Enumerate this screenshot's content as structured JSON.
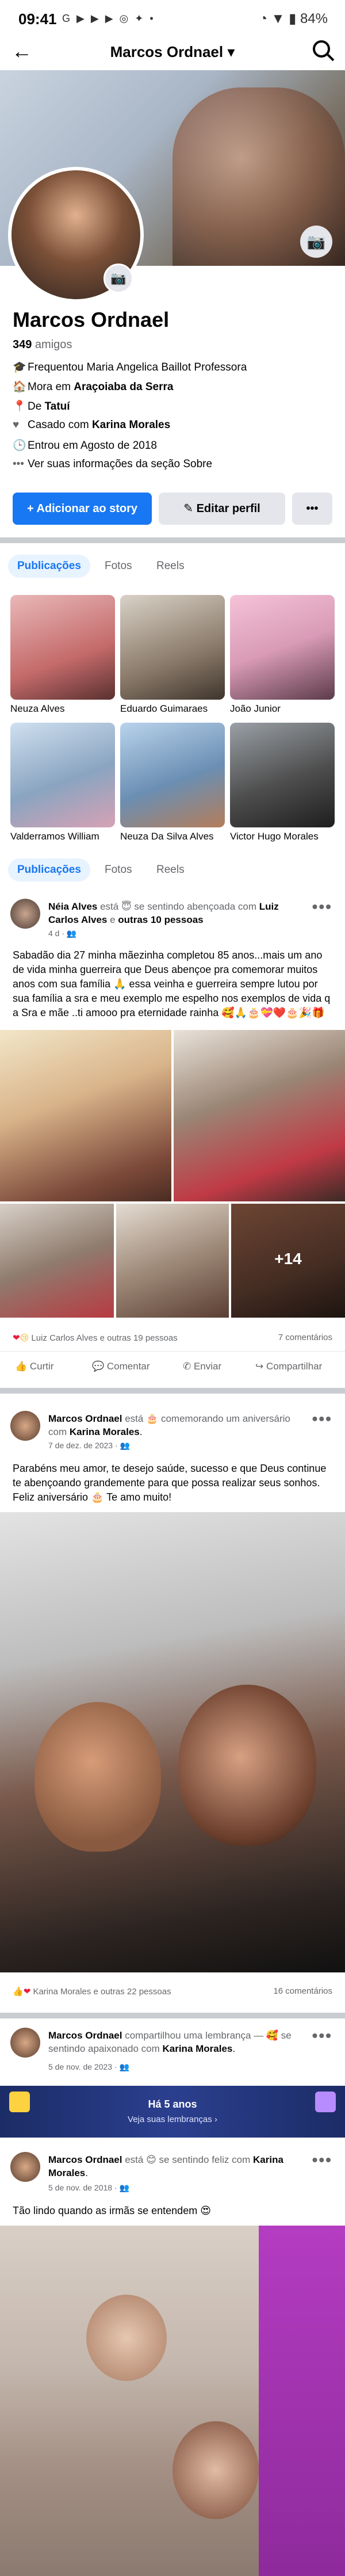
{
  "status_bar": {
    "time": "09:41",
    "icons": "G ▶ ▶ ▶ ◎ ✦ •",
    "right": "◔ ▼ ▮ 84%"
  },
  "top_bar": {
    "title": "Marcos Ordnael ▾"
  },
  "profile": {
    "name": "Marcos Ordnael",
    "friends_count": "349",
    "friends_label": " amigos",
    "info": [
      {
        "icon": "🎓",
        "prefix": "Frequentou ",
        "bold": "",
        "text": "Maria Angelica Baillot Professora"
      },
      {
        "icon": "🏠",
        "prefix": "Mora em ",
        "bold": "Araçoiaba da Serra",
        "text": ""
      },
      {
        "icon": "📍",
        "prefix": "De ",
        "bold": "Tatuí",
        "text": ""
      },
      {
        "icon": "♥",
        "prefix": "Casado com ",
        "bold": "Karina Morales",
        "text": ""
      },
      {
        "icon": "🕒",
        "prefix": "Entrou em Agosto de 2018",
        "bold": "",
        "text": ""
      },
      {
        "icon": "•••",
        "prefix": "Ver suas informações da seção Sobre",
        "bold": "",
        "text": ""
      }
    ],
    "btn_add": "+ Adicionar ao story",
    "btn_edit": "✎ Editar perfil",
    "btn_more": "•••"
  },
  "tabs": [
    "Publicações",
    "Fotos",
    "Reels"
  ],
  "friends_grid": [
    {
      "name": "Neuza Alves",
      "color": "#c46a6a"
    },
    {
      "name": "Eduardo Guimaraes",
      "color": "#8a7a6a"
    },
    {
      "name": "João Junior",
      "color": "#d99bb6"
    },
    {
      "name": "Valderramos William",
      "color": "#8aa4c0"
    },
    {
      "name": "Neuza Da Silva Alves",
      "color": "#6b8fb3"
    },
    {
      "name": "Victor Hugo Morales",
      "color": "#4e4e4e"
    }
  ],
  "post1": {
    "author": "Néia Alves",
    "middle": " está 😇 se sentindo abençoada com ",
    "with": "Luiz Carlos Alves",
    "and": " e ",
    "others": "outras 10 pessoas",
    "time": "4 d · 👥",
    "text": "Sabadão dia 27 minha mãezinha completou 85 anos...mais um ano de vida minha guerreira que Deus abençoe pra comemorar muitos anos com sua família 🙏 essa veinha e guerreira sempre lutou por sua família a sra e meu exemplo  me espelho nos exemplos de vida q a Sra e mãe ..ti amooo pra eternidade rainha 🥰🙏🎂💝❤️🎂🎉🎁",
    "more_photos": "+14",
    "reactions": "Luiz Carlos Alves e outras 19 pessoas",
    "comments": "7 comentários"
  },
  "actions": [
    "Curtir",
    "Comentar",
    "Enviar",
    "Compartilhar"
  ],
  "post2": {
    "author": "Marcos Ordnael",
    "middle": " está 🎂 comemorando um aniversário com ",
    "with": "Karina Morales",
    "time": "7 de dez. de 2023 · 👥",
    "text": "Parabéns meu amor, te desejo saúde, sucesso e que Deus continue te abençoando grandemente para que possa realizar seus sonhos. Feliz aniversário 🎂  Te amo muito!",
    "reactions": "Karina Morales e outras 22 pessoas",
    "comments": "16 comentários"
  },
  "post3": {
    "author": "Marcos Ordnael",
    "middle": " compartilhou uma lembrança — 🥰 se sentindo apaixonado com ",
    "with": "Karina Morales",
    "time": "5 de nov. de 2023 · 👥",
    "memory_title": "Há 5 anos",
    "memory_sub": "Veja suas lembranças ›"
  },
  "post4": {
    "author": "Marcos Ordnael",
    "middle": " está 😊 se sentindo feliz com ",
    "with": "Karina Morales",
    "time": "5 de nov. de 2018 · 👥",
    "text": "Tão lindo quando as irmãs se entendem 😍"
  }
}
